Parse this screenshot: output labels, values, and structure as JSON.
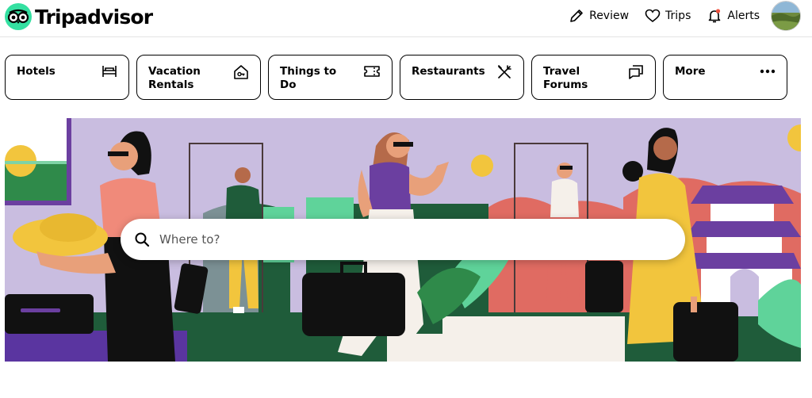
{
  "brand": {
    "name": "Tripadvisor",
    "accent": "#34e0a1"
  },
  "nav": {
    "review_label": "Review",
    "trips_label": "Trips",
    "alerts_label": "Alerts"
  },
  "categories": [
    {
      "label": "Hotels",
      "icon": "bed-icon"
    },
    {
      "label": "Vacation Rentals",
      "icon": "house-icon"
    },
    {
      "label": "Things to Do",
      "icon": "ticket-icon"
    },
    {
      "label": "Restaurants",
      "icon": "fork-knife-icon"
    },
    {
      "label": "Travel Forums",
      "icon": "chat-bubbles-icon"
    },
    {
      "label": "More",
      "icon": "more-dots-icon"
    }
  ],
  "search": {
    "placeholder": "Where to?"
  },
  "colors": {
    "hero_bg": "#c9bde0",
    "alert_dot": "#f05340"
  }
}
